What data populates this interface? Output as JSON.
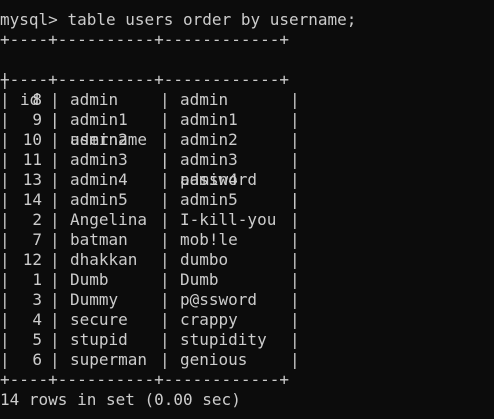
{
  "terminal": {
    "prompt": "mysql> ",
    "command": "table users order by username;",
    "border_line": "+----+----------+------------+",
    "header_line": "| id | username | password   |",
    "columns": [
      "id",
      "username",
      "password"
    ],
    "rows": [
      {
        "id": "8",
        "username": "admin",
        "password": "admin"
      },
      {
        "id": "9",
        "username": "admin1",
        "password": "admin1"
      },
      {
        "id": "10",
        "username": "admin2",
        "password": "admin2"
      },
      {
        "id": "11",
        "username": "admin3",
        "password": "admin3"
      },
      {
        "id": "13",
        "username": "admin4",
        "password": "admin4"
      },
      {
        "id": "14",
        "username": "admin5",
        "password": "admin5"
      },
      {
        "id": "2",
        "username": "Angelina",
        "password": "I-kill-you"
      },
      {
        "id": "7",
        "username": "batman",
        "password": "mob!le"
      },
      {
        "id": "12",
        "username": "dhakkan",
        "password": "dumbo"
      },
      {
        "id": "1",
        "username": "Dumb",
        "password": "Dumb"
      },
      {
        "id": "3",
        "username": "Dummy",
        "password": "p@ssword"
      },
      {
        "id": "4",
        "username": "secure",
        "password": "crappy"
      },
      {
        "id": "5",
        "username": "stupid",
        "password": "stupidity"
      },
      {
        "id": "6",
        "username": "superman",
        "password": "genious"
      }
    ],
    "footer": "14 rows in set (0.00 sec)",
    "colors": {
      "background": "#0c0c0c",
      "foreground": "#cccccc"
    }
  }
}
